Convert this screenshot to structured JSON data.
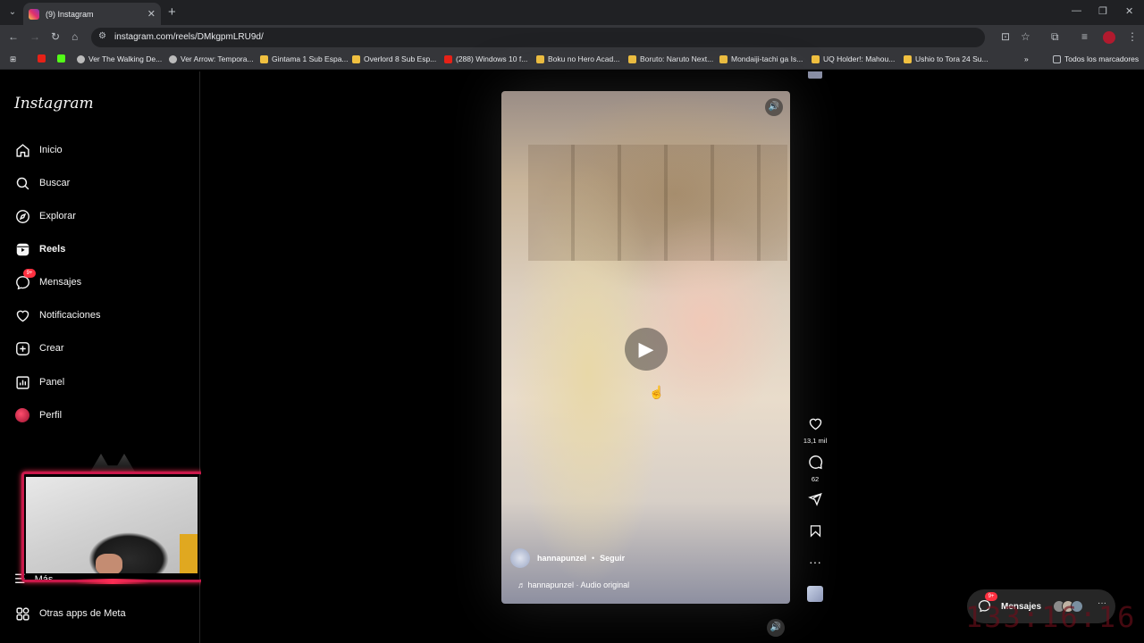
{
  "browser": {
    "tab_title": "(9) Instagram",
    "url": "instagram.com/reels/DMkgpmLRU9d/",
    "bookmarks": [
      "Ver The Walking De...",
      "Ver Arrow: Tempora...",
      "Gintama 1 Sub Espa...",
      "Overlord 8 Sub Esp...",
      "(288) Windows 10 f...",
      "Boku no Hero Acad...",
      "Boruto: Naruto Next...",
      "Mondaiji-tachi ga Is...",
      "UQ Holder!: Mahou...",
      "Ushio to Tora 24 Su..."
    ],
    "all_bookmarks": "Todos los marcadores"
  },
  "sidebar": {
    "logo": "Instagram",
    "items": [
      {
        "label": "Inicio",
        "icon": "home-icon"
      },
      {
        "label": "Buscar",
        "icon": "search-icon"
      },
      {
        "label": "Explorar",
        "icon": "compass-icon"
      },
      {
        "label": "Reels",
        "icon": "reels-icon"
      },
      {
        "label": "Mensajes",
        "icon": "messenger-icon",
        "badge": "9+"
      },
      {
        "label": "Notificaciones",
        "icon": "heart-icon"
      },
      {
        "label": "Crear",
        "icon": "plus-square-icon"
      },
      {
        "label": "Panel",
        "icon": "dashboard-icon"
      },
      {
        "label": "Perfil",
        "icon": "avatar"
      }
    ],
    "more": "Más",
    "meta_apps": "Otras apps de Meta"
  },
  "reel": {
    "username": "hannapunzel",
    "follow": "Seguir",
    "separator": "•",
    "audio": "♬ hannapunzel · Audio original",
    "likes": "13,1 mil",
    "comments": "62"
  },
  "messages": {
    "label": "Mensajes",
    "badge": "9+"
  },
  "overlay_timer": "133:16:16",
  "colors": {
    "accent_red": "#ff3040",
    "cam_border": "#c9184a"
  }
}
